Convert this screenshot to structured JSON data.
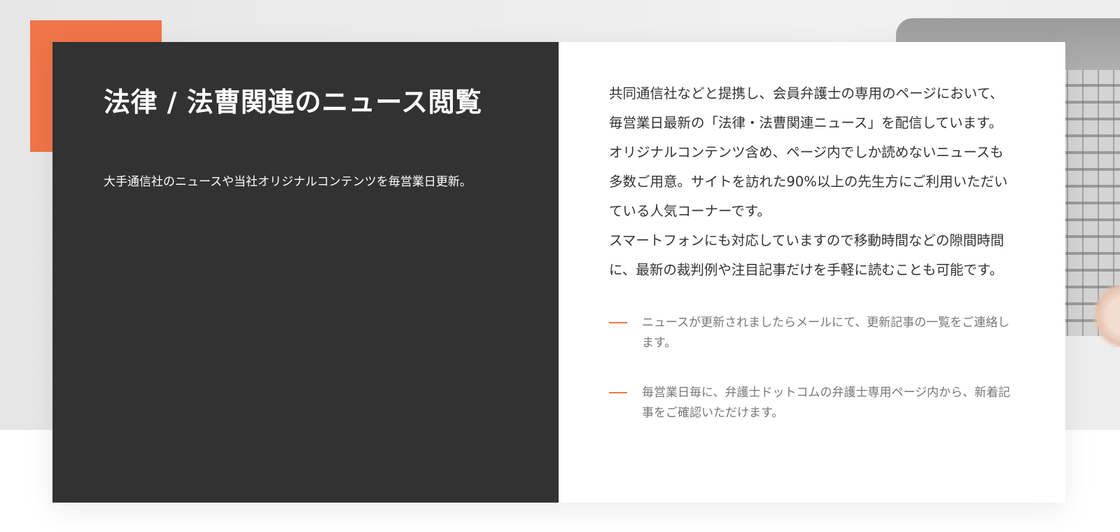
{
  "section": {
    "title": "法律 / 法曹関連のニュース閲覧",
    "subtitle": "大手通信社のニュースや当社オリジナルコンテンツを毎営業日更新。",
    "description": "共同通信社などと提携し、会員弁護士の専用のページにおいて、毎営業日最新の「法律・法曹関連ニュース」を配信しています。オリジナルコンテンツ含め、ページ内でしか読めないニュースも多数ご用意。サイトを訪れた90%以上の先生方にご利用いただいている人気コーナーです。",
    "description_2": "スマートフォンにも対応していますので移動時間などの隙間時間に、最新の裁判例や注目記事だけを手軽に読むことも可能です。",
    "features": [
      "ニュースが更新されましたらメールにて、更新記事の一覧をご連絡します。",
      "毎営業日毎に、弁護士ドットコムの弁護士専用ページ内から、新着記事をご確認いただけます。"
    ]
  },
  "colors": {
    "accent": "#f07548",
    "dark_panel": "#323232",
    "body_text": "#333333",
    "muted_text": "#777777"
  },
  "icons": {
    "feature_marker": "dash-icon"
  }
}
